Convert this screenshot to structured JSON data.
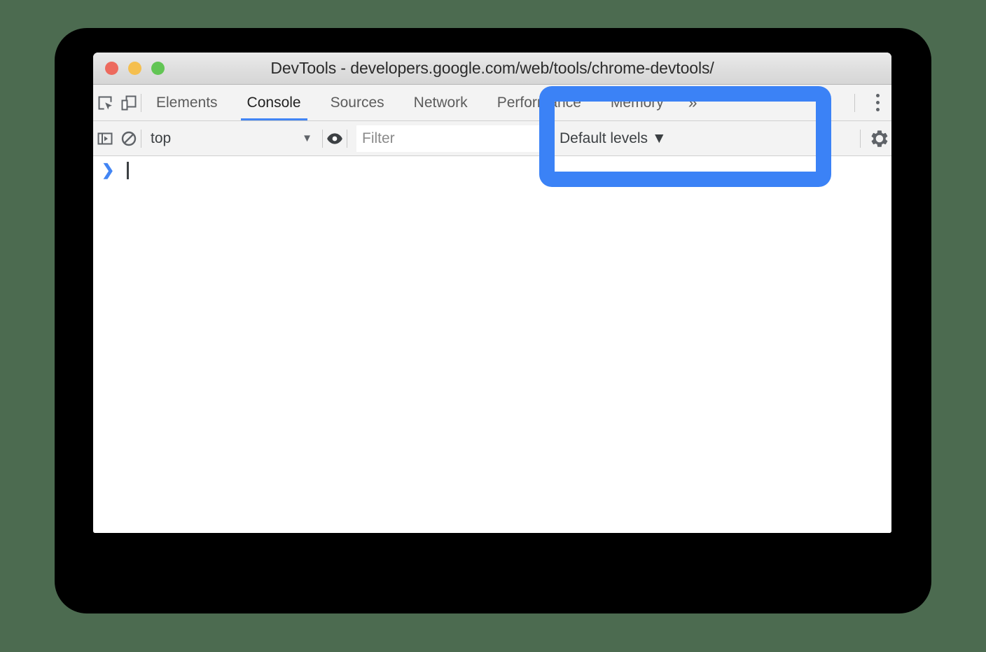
{
  "window": {
    "title": "DevTools - developers.google.com/web/tools/chrome-devtools/",
    "traffic_lights": [
      {
        "name": "close",
        "color": "#ed6a5e"
      },
      {
        "name": "minimize",
        "color": "#f5bf4f"
      },
      {
        "name": "zoom",
        "color": "#62c554"
      }
    ]
  },
  "toolbar": {
    "inspect_icon": "inspect-element-icon",
    "device_icon": "device-toolbar-icon",
    "overflow_label": "»",
    "menu_icon": "kebab-menu-icon"
  },
  "tabs": [
    {
      "label": "Elements",
      "active": false
    },
    {
      "label": "Console",
      "active": true
    },
    {
      "label": "Sources",
      "active": false
    },
    {
      "label": "Network",
      "active": false
    },
    {
      "label": "Performance",
      "active": false
    },
    {
      "label": "Memory",
      "active": false
    }
  ],
  "filter_bar": {
    "sidebar_toggle_icon": "console-sidebar-icon",
    "clear_icon": "clear-console-icon",
    "context_value": "top",
    "context_caret": "▼",
    "eye_icon": "live-expression-icon",
    "filter_value": "",
    "filter_placeholder": "Filter",
    "levels_label": "Default levels ▼",
    "settings_icon": "gear-icon"
  },
  "console": {
    "prompt_arrow": "❯"
  },
  "annotation": {
    "highlight_color": "#3b82f6",
    "name": "log-level-highlight"
  }
}
